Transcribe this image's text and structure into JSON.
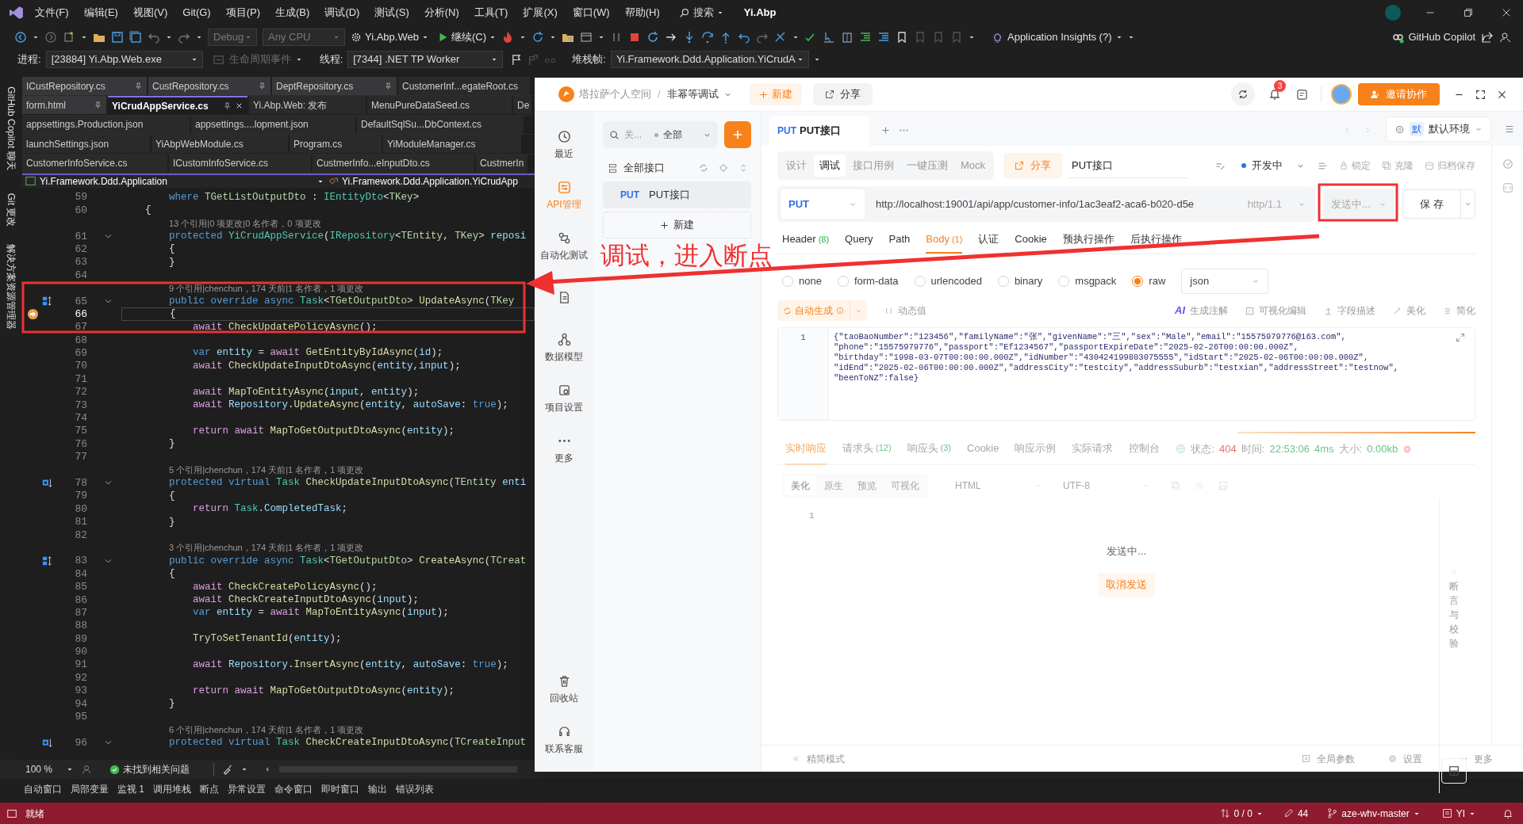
{
  "vs": {
    "menu": [
      "文件(F)",
      "编辑(E)",
      "视图(V)",
      "Git(G)",
      "项目(P)",
      "生成(B)",
      "调试(D)",
      "测试(S)",
      "分析(N)",
      "工具(T)",
      "扩展(X)",
      "窗口(W)",
      "帮助(H)"
    ],
    "search": "搜索",
    "solution_name": "Yi.Abp",
    "toolbar": {
      "configuration": "Debug",
      "platform": "Any CPU",
      "startup_project": "Yi.Abp.Web",
      "continue": "继续(C)",
      "insights": "Application Insights (?)",
      "copilot": "GitHub Copilot"
    },
    "debug_location": {
      "process_label": "进程:",
      "process": "[23884] Yi.Abp.Web.exe",
      "lifecycle": "生命周期事件",
      "thread_label": "线程:",
      "thread": "[7344] .NET TP Worker",
      "stack_label": "堆栈帧:",
      "stack_frame": "Yi.Framework.Ddd.Application.YiCrudA"
    },
    "side_panels": [
      "GitHub Copilot 聊天",
      "Git 更改",
      "解决方案资源管理器"
    ],
    "document_tabs": [
      [
        {
          "label": "ICustRepository.cs",
          "pinned": true,
          "selected": false
        },
        {
          "label": "CustRepository.cs",
          "pinned": true,
          "selected": false
        },
        {
          "label": "DeptRepository.cs",
          "pinned": true,
          "selected": false
        },
        {
          "label": "CustomerInf...egateRoot.cs",
          "pinned": false,
          "selected": false
        }
      ],
      [
        {
          "label": "form.html",
          "pinned": true,
          "selected": false
        },
        {
          "label": "YiCrudAppService.cs",
          "pinned": true,
          "selected": true
        },
        {
          "label": "Yi.Abp.Web: 发布",
          "pinned": false,
          "selected": false
        },
        {
          "label": "MenuPureDataSeed.cs",
          "pinned": false,
          "selected": false
        },
        {
          "label": "De",
          "pinned": false,
          "selected": false
        }
      ],
      [
        {
          "label": "appsettings.Production.json",
          "pinned": false,
          "selected": false
        },
        {
          "label": "appsettings....lopment.json",
          "pinned": false,
          "selected": false
        },
        {
          "label": "DefaultSqlSu...DbContext.cs",
          "pinned": false,
          "selected": false
        }
      ],
      [
        {
          "label": "launchSettings.json",
          "pinned": false,
          "selected": false
        },
        {
          "label": "YiAbpWebModule.cs",
          "pinned": false,
          "selected": false
        },
        {
          "label": "Program.cs",
          "pinned": false,
          "selected": false
        },
        {
          "label": "YiModuleManager.cs",
          "pinned": false,
          "selected": false
        }
      ],
      [
        {
          "label": "CustomerInfoService.cs",
          "pinned": false,
          "selected": false
        },
        {
          "label": "ICustomInfoService.cs",
          "pinned": false,
          "selected": false
        },
        {
          "label": "CustmerInfo...eInputDto.cs",
          "pinned": false,
          "selected": false
        },
        {
          "label": "CustmerIn",
          "pinned": false,
          "selected": false
        }
      ]
    ],
    "navigation": {
      "project": "Yi.Framework.Ddd.Application",
      "member": "Yi.Framework.Ddd.Application.YiCrudApp"
    },
    "code_lines": [
      {
        "kind": "code",
        "number": "59",
        "fold": false,
        "parts": [
          {
            "kind": "keyword",
            "text": "        where "
          },
          {
            "kind": "generic",
            "text": "TGetListOutputDto"
          },
          {
            "kind": "plain",
            "text": " : "
          },
          {
            "kind": "type",
            "text": "IEntityDto"
          },
          {
            "kind": "plain",
            "text": "<"
          },
          {
            "kind": "generic",
            "text": "TKey"
          },
          {
            "kind": "plain",
            "text": ">"
          }
        ]
      },
      {
        "kind": "code",
        "number": "60",
        "fold": false,
        "parts": [
          {
            "kind": "plain",
            "text": "    {"
          }
        ]
      },
      {
        "kind": "lens",
        "text": "13 个引用|0 项更改|0 名作者，0 项更改"
      },
      {
        "kind": "code",
        "number": "61",
        "fold": true,
        "parts": [
          {
            "kind": "keyword",
            "text": "        protected "
          },
          {
            "kind": "type",
            "text": "YiCrudAppService"
          },
          {
            "kind": "plain",
            "text": "("
          },
          {
            "kind": "type",
            "text": "IRepository"
          },
          {
            "kind": "plain",
            "text": "<"
          },
          {
            "kind": "generic",
            "text": "TEntity"
          },
          {
            "kind": "plain",
            "text": ", "
          },
          {
            "kind": "generic",
            "text": "TKey"
          },
          {
            "kind": "plain",
            "text": "> "
          },
          {
            "kind": "variable",
            "text": "reposi"
          }
        ]
      },
      {
        "kind": "code",
        "number": "62",
        "fold": false,
        "parts": [
          {
            "kind": "plain",
            "text": "        {"
          }
        ]
      },
      {
        "kind": "code",
        "number": "63",
        "fold": false,
        "parts": [
          {
            "kind": "plain",
            "text": "        }"
          }
        ]
      },
      {
        "kind": "code",
        "number": "64",
        "fold": false
      },
      {
        "kind": "lens",
        "text": "9 个引用|chenchun，174 天前|1 名作者，1 项更改"
      },
      {
        "kind": "code",
        "number": "65",
        "fold": true,
        "glyph": {
          "kind": "override"
        },
        "parts": [
          {
            "kind": "keyword",
            "text": "        public override async "
          },
          {
            "kind": "type",
            "text": "Task"
          },
          {
            "kind": "plain",
            "text": "<"
          },
          {
            "kind": "generic",
            "text": "TGetOutputDto"
          },
          {
            "kind": "plain",
            "text": "> "
          },
          {
            "kind": "method",
            "text": "UpdateAsync"
          },
          {
            "kind": "plain",
            "text": "("
          },
          {
            "kind": "generic",
            "text": "TKey"
          }
        ]
      },
      {
        "kind": "code",
        "number": "66",
        "fold": false,
        "glyph": {
          "kind": "current"
        },
        "parts": [
          {
            "kind": "plain",
            "text": "        {"
          }
        ]
      },
      {
        "kind": "code",
        "number": "67",
        "fold": false,
        "parts": [
          {
            "kind": "control",
            "text": "            await "
          },
          {
            "kind": "method",
            "text": "CheckUpdatePolicyAsync"
          },
          {
            "kind": "plain",
            "text": "();"
          }
        ]
      },
      {
        "kind": "code",
        "number": "68",
        "fold": false
      },
      {
        "kind": "code",
        "number": "69",
        "fold": false,
        "parts": [
          {
            "kind": "keyword",
            "text": "            var "
          },
          {
            "kind": "variable",
            "text": "entity"
          },
          {
            "kind": "plain",
            "text": " = "
          },
          {
            "kind": "control",
            "text": "await "
          },
          {
            "kind": "method",
            "text": "GetEntityByIdAsync"
          },
          {
            "kind": "plain",
            "text": "("
          },
          {
            "kind": "variable",
            "text": "id"
          },
          {
            "kind": "plain",
            "text": ");"
          }
        ]
      },
      {
        "kind": "code",
        "number": "70",
        "fold": false,
        "parts": [
          {
            "kind": "control",
            "text": "            await "
          },
          {
            "kind": "method",
            "text": "CheckUpdateInputDtoAsync"
          },
          {
            "kind": "plain",
            "text": "("
          },
          {
            "kind": "variable",
            "text": "entity"
          },
          {
            "kind": "plain",
            "text": ","
          },
          {
            "kind": "variable",
            "text": "input"
          },
          {
            "kind": "plain",
            "text": ");"
          }
        ]
      },
      {
        "kind": "code",
        "number": "71",
        "fold": false
      },
      {
        "kind": "code",
        "number": "72",
        "fold": false,
        "parts": [
          {
            "kind": "control",
            "text": "            await "
          },
          {
            "kind": "method",
            "text": "MapToEntityAsync"
          },
          {
            "kind": "plain",
            "text": "("
          },
          {
            "kind": "variable",
            "text": "input"
          },
          {
            "kind": "plain",
            "text": ", "
          },
          {
            "kind": "variable",
            "text": "entity"
          },
          {
            "kind": "plain",
            "text": ");"
          }
        ]
      },
      {
        "kind": "code",
        "number": "73",
        "fold": false,
        "parts": [
          {
            "kind": "control",
            "text": "            await "
          },
          {
            "kind": "variable",
            "text": "Repository"
          },
          {
            "kind": "plain",
            "text": "."
          },
          {
            "kind": "method",
            "text": "UpdateAsync"
          },
          {
            "kind": "plain",
            "text": "("
          },
          {
            "kind": "variable",
            "text": "entity"
          },
          {
            "kind": "plain",
            "text": ", "
          },
          {
            "kind": "variable",
            "text": "autoSave"
          },
          {
            "kind": "plain",
            "text": ": "
          },
          {
            "kind": "keyword",
            "text": "true"
          },
          {
            "kind": "plain",
            "text": ");"
          }
        ]
      },
      {
        "kind": "code",
        "number": "74",
        "fold": false
      },
      {
        "kind": "code",
        "number": "75",
        "fold": false,
        "parts": [
          {
            "kind": "control",
            "text": "            return await "
          },
          {
            "kind": "method",
            "text": "MapToGetOutputDtoAsync"
          },
          {
            "kind": "plain",
            "text": "("
          },
          {
            "kind": "variable",
            "text": "entity"
          },
          {
            "kind": "plain",
            "text": ");"
          }
        ]
      },
      {
        "kind": "code",
        "number": "76",
        "fold": false,
        "parts": [
          {
            "kind": "plain",
            "text": "        }"
          }
        ]
      },
      {
        "kind": "code",
        "number": "77",
        "fold": false
      },
      {
        "kind": "lens",
        "text": "5 个引用|chenchun，174 天前|1 名作者，1 项更改"
      },
      {
        "kind": "code",
        "number": "78",
        "fold": true,
        "glyph": {
          "kind": "overridden"
        },
        "parts": [
          {
            "kind": "keyword",
            "text": "        protected virtual "
          },
          {
            "kind": "type",
            "text": "Task "
          },
          {
            "kind": "method",
            "text": "CheckUpdateInputDtoAsync"
          },
          {
            "kind": "plain",
            "text": "("
          },
          {
            "kind": "generic",
            "text": "TEntity "
          },
          {
            "kind": "variable",
            "text": "enti"
          }
        ]
      },
      {
        "kind": "code",
        "number": "79",
        "fold": false,
        "parts": [
          {
            "kind": "plain",
            "text": "        {"
          }
        ]
      },
      {
        "kind": "code",
        "number": "80",
        "fold": false,
        "parts": [
          {
            "kind": "control",
            "text": "            return "
          },
          {
            "kind": "type",
            "text": "Task"
          },
          {
            "kind": "plain",
            "text": "."
          },
          {
            "kind": "variable",
            "text": "CompletedTask"
          },
          {
            "kind": "plain",
            "text": ";"
          }
        ]
      },
      {
        "kind": "code",
        "number": "81",
        "fold": false,
        "parts": [
          {
            "kind": "plain",
            "text": "        }"
          }
        ]
      },
      {
        "kind": "code",
        "number": "82",
        "fold": false
      },
      {
        "kind": "lens",
        "text": "3 个引用|chenchun，174 天前|1 名作者，1 项更改"
      },
      {
        "kind": "code",
        "number": "83",
        "fold": true,
        "glyph": {
          "kind": "override"
        },
        "parts": [
          {
            "kind": "keyword",
            "text": "        public override async "
          },
          {
            "kind": "type",
            "text": "Task"
          },
          {
            "kind": "plain",
            "text": "<"
          },
          {
            "kind": "generic",
            "text": "TGetOutputDto"
          },
          {
            "kind": "plain",
            "text": "> "
          },
          {
            "kind": "method",
            "text": "CreateAsync"
          },
          {
            "kind": "plain",
            "text": "("
          },
          {
            "kind": "generic",
            "text": "TCreat"
          }
        ]
      },
      {
        "kind": "code",
        "number": "84",
        "fold": false,
        "parts": [
          {
            "kind": "plain",
            "text": "        {"
          }
        ]
      },
      {
        "kind": "code",
        "number": "85",
        "fold": false,
        "parts": [
          {
            "kind": "control",
            "text": "            await "
          },
          {
            "kind": "method",
            "text": "CheckCreatePolicyAsync"
          },
          {
            "kind": "plain",
            "text": "();"
          }
        ]
      },
      {
        "kind": "code",
        "number": "86",
        "fold": false,
        "parts": [
          {
            "kind": "control",
            "text": "            await "
          },
          {
            "kind": "method",
            "text": "CheckCreateInputDtoAsync"
          },
          {
            "kind": "plain",
            "text": "("
          },
          {
            "kind": "variable",
            "text": "input"
          },
          {
            "kind": "plain",
            "text": ");"
          }
        ]
      },
      {
        "kind": "code",
        "number": "87",
        "fold": false,
        "parts": [
          {
            "kind": "keyword",
            "text": "            var "
          },
          {
            "kind": "variable",
            "text": "entity"
          },
          {
            "kind": "plain",
            "text": " = "
          },
          {
            "kind": "control",
            "text": "await "
          },
          {
            "kind": "method",
            "text": "MapToEntityAsync"
          },
          {
            "kind": "plain",
            "text": "("
          },
          {
            "kind": "variable",
            "text": "input"
          },
          {
            "kind": "plain",
            "text": ");"
          }
        ]
      },
      {
        "kind": "code",
        "number": "88",
        "fold": false
      },
      {
        "kind": "code",
        "number": "89",
        "fold": false,
        "parts": [
          {
            "kind": "method",
            "text": "            TryToSetTenantId"
          },
          {
            "kind": "plain",
            "text": "("
          },
          {
            "kind": "variable",
            "text": "entity"
          },
          {
            "kind": "plain",
            "text": ");"
          }
        ]
      },
      {
        "kind": "code",
        "number": "90",
        "fold": false
      },
      {
        "kind": "code",
        "number": "91",
        "fold": false,
        "parts": [
          {
            "kind": "control",
            "text": "            await "
          },
          {
            "kind": "variable",
            "text": "Repository"
          },
          {
            "kind": "plain",
            "text": "."
          },
          {
            "kind": "method",
            "text": "InsertAsync"
          },
          {
            "kind": "plain",
            "text": "("
          },
          {
            "kind": "variable",
            "text": "entity"
          },
          {
            "kind": "plain",
            "text": ", "
          },
          {
            "kind": "variable",
            "text": "autoSave"
          },
          {
            "kind": "plain",
            "text": ": "
          },
          {
            "kind": "keyword",
            "text": "true"
          },
          {
            "kind": "plain",
            "text": ");"
          }
        ]
      },
      {
        "kind": "code",
        "number": "92",
        "fold": false
      },
      {
        "kind": "code",
        "number": "93",
        "fold": false,
        "parts": [
          {
            "kind": "control",
            "text": "            return await "
          },
          {
            "kind": "method",
            "text": "MapToGetOutputDtoAsync"
          },
          {
            "kind": "plain",
            "text": "("
          },
          {
            "kind": "variable",
            "text": "entity"
          },
          {
            "kind": "plain",
            "text": ");"
          }
        ]
      },
      {
        "kind": "code",
        "number": "94",
        "fold": false,
        "parts": [
          {
            "kind": "plain",
            "text": "        }"
          }
        ]
      },
      {
        "kind": "code",
        "number": "95",
        "fold": false
      },
      {
        "kind": "lens",
        "text": "6 个引用|chenchun，174 天前|1 名作者，1 项更改"
      },
      {
        "kind": "code",
        "number": "96",
        "fold": true,
        "glyph": {
          "kind": "overridden"
        },
        "parts": [
          {
            "kind": "keyword",
            "text": "        protected virtual "
          },
          {
            "kind": "type",
            "text": "Task "
          },
          {
            "kind": "method",
            "text": "CheckCreateInputDtoAsync"
          },
          {
            "kind": "plain",
            "text": "("
          },
          {
            "kind": "generic",
            "text": "TCreateInput"
          }
        ]
      }
    ],
    "editor_status": {
      "zoom": "100 %",
      "issues": "未找到相关问题"
    },
    "tool_tabs": [
      "自动窗口",
      "局部变量",
      "监视 1",
      "调用堆栈",
      "断点",
      "异常设置",
      "命令窗口",
      "即时窗口",
      "输出",
      "错误列表"
    ],
    "status_bar": {
      "state": "就绪",
      "changes": "0 / 0",
      "edits": "44",
      "branch": "aze-whv-master",
      "repo": "YI"
    }
  },
  "apifox": {
    "breadcrumb": {
      "space": "塔拉萨个人空间",
      "separator": "/",
      "project": "非幂等调试"
    },
    "new_button": "新建",
    "share_button": "分享",
    "notifications": "3",
    "invite": "邀请协作",
    "rail": [
      {
        "kind": "recent",
        "label": "最近",
        "selected": false
      },
      {
        "kind": "api",
        "label": "API管理",
        "selected": true
      },
      {
        "kind": "automation",
        "label": "自动化测试",
        "selected": false
      },
      {
        "kind": "docs",
        "selected": false
      },
      {
        "kind": "model",
        "label": "数据模型",
        "selected": false
      },
      {
        "kind": "settings",
        "label": "项目设置",
        "selected": false
      },
      {
        "kind": "more",
        "label": "更多",
        "selected": false
      }
    ],
    "rail_bottom": [
      {
        "kind": "trash",
        "label": "回收站"
      },
      {
        "kind": "support",
        "label": "联系客服"
      }
    ],
    "tree": {
      "search_placeholder": "关...",
      "filter": "全部",
      "root": "全部接口",
      "items": [
        {
          "method": "PUT",
          "name": "PUT接口",
          "selected": true
        }
      ],
      "new": "新建"
    },
    "tabs": [
      {
        "method": "PUT",
        "name": "PUT接口",
        "selected": true
      }
    ],
    "environment": {
      "badge": "默",
      "name": "默认环境"
    },
    "modes": [
      {
        "label": "设计",
        "selected": false
      },
      {
        "label": "调试",
        "selected": true
      },
      {
        "label": "接口用例",
        "selected": false
      },
      {
        "label": "一键压测",
        "selected": false
      },
      {
        "label": "Mock",
        "selected": false
      }
    ],
    "share": "分享",
    "endpoint_name": "PUT接口",
    "status": "开发中",
    "actions": [
      "锁定",
      "克隆",
      "归档保存"
    ],
    "request": {
      "method": "PUT",
      "url": "http://localhost:19001/api/app/customer-info/1ac3eaf2-aca6-b020-d5e",
      "protocol": "http/1.1",
      "send": "发送中...",
      "disabled": true,
      "save": "保 存"
    },
    "request_tabs": [
      {
        "label": "Header",
        "count": "(8)",
        "selected": false
      },
      {
        "label": "Query",
        "selected": false
      },
      {
        "label": "Path",
        "selected": false
      },
      {
        "label": "Body",
        "count": "(1)",
        "selected": true
      },
      {
        "label": "认证",
        "selected": false
      },
      {
        "label": "Cookie",
        "selected": false
      },
      {
        "label": "预执行操作",
        "selected": false
      },
      {
        "label": "后执行操作",
        "selected": false
      }
    ],
    "body_types": [
      {
        "label": "none",
        "selected": false
      },
      {
        "label": "form-data",
        "selected": false
      },
      {
        "label": "urlencoded",
        "selected": false
      },
      {
        "label": "binary",
        "selected": false
      },
      {
        "label": "msgpack",
        "selected": false
      },
      {
        "label": "raw",
        "selected": true
      }
    ],
    "body_format": "json",
    "body_tools": {
      "auto": "自动生成",
      "dynamic": "动态值",
      "ai_badge": "AI",
      "ai": "生成注解",
      "visual": "可视化编辑",
      "fields": "字段描述",
      "beautify": "美化",
      "simplify": "简化"
    },
    "body_line_number": "1",
    "body_lines": [
      "{\"taoBaoNumber\":\"123456\",\"familyName\":\"张\",\"givenName\":\"三\",\"sex\":\"Male\",\"email\":\"15575979776@163.com\",",
      "\"phone\":\"15575979776\",\"passport\":\"Ef1234567\",\"passportExpireDate\":\"2025-02-26T00:00:00.000Z\",",
      "\"birthday\":\"1998-03-07T00:00:00.000Z\",\"idNumber\":\"430424199803075555\",\"idStart\":\"2025-02-06T00:00:00.000Z\",",
      "\"idEnd\":\"2025-02-06T00:00:00.000Z\",\"addressCity\":\"testcity\",\"addressSuburb\":\"testxian\",\"addressStreet\":\"testnow\",",
      "\"beenToNZ\":false}"
    ],
    "response": {
      "tabs": [
        {
          "label": "实时响应",
          "selected": true
        },
        {
          "label": "请求头",
          "count": "(12)",
          "selected": false
        },
        {
          "label": "响应头",
          "count": "(3)",
          "selected": false
        },
        {
          "label": "Cookie",
          "selected": false
        },
        {
          "label": "响应示例",
          "selected": false
        },
        {
          "label": "实际请求",
          "selected": false
        },
        {
          "label": "控制台",
          "selected": false
        }
      ],
      "status_label": "状态:",
      "status": "404",
      "time_label": "时间:",
      "time": "22:53:06",
      "duration": "4ms",
      "size_label": "大小:",
      "size": "0.00kb",
      "views": [
        {
          "label": "美化",
          "selected": true
        },
        {
          "label": "原生",
          "selected": false
        },
        {
          "label": "预览",
          "selected": false
        },
        {
          "label": "可视化",
          "selected": false
        }
      ],
      "format": "HTML",
      "encoding": "UTF-8",
      "line_number": "1",
      "message": "发送中...",
      "cancel": "取消发送",
      "side_panel": "断言与校验"
    },
    "footer": {
      "compact": "精简模式",
      "global_params": "全局参数",
      "settings": "设置",
      "more": "更多"
    }
  },
  "annotation": {
    "text": "调试，进入断点"
  }
}
